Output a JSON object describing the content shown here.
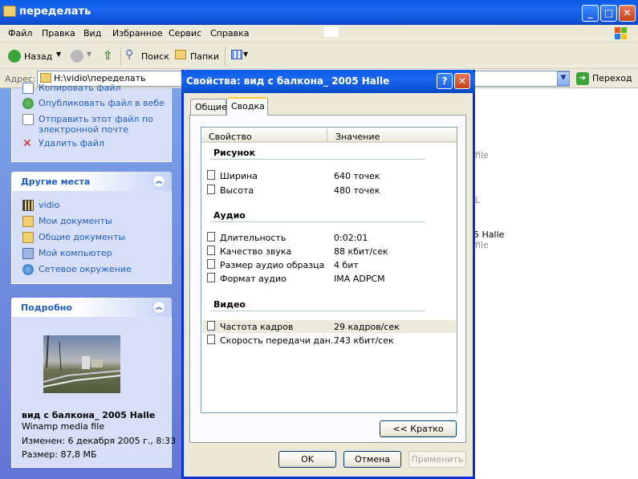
{
  "window": {
    "title": "переделать",
    "menu": [
      "Файл",
      "Правка",
      "Вид",
      "Избранное",
      "Сервис",
      "Справка"
    ],
    "toolbar": {
      "back": "Назад",
      "search": "Поиск",
      "folders": "Папки"
    },
    "address": {
      "label": "Адрес:",
      "value": "H:\\vidio\\переделать",
      "go": "Переход"
    }
  },
  "left_pane": {
    "tasks": [
      "Копировать файл",
      "Опубликовать файл в вебе",
      "Отправить этот файл по",
      "электронной почте",
      "Удалить файл"
    ],
    "other_places": {
      "title": "Другие места",
      "items": [
        "vidio",
        "Мои документы",
        "Общие документы",
        "Мой компьютер",
        "Сетевое окружение"
      ]
    },
    "details": {
      "title": "Подробно",
      "name": "вид с балкона_ 2005 Halle",
      "type": "Winamp media file",
      "modified": "Изменен: 6 декабря 2005 г., 8:33",
      "size": "Размер: 87,8 МБ"
    }
  },
  "main_ghost": [
    "file",
    "L",
    "5 Halle",
    "file"
  ],
  "dialog": {
    "title": "Свойства: вид с балкона_ 2005 Halle",
    "tabs": [
      "Общие",
      "Сводка"
    ],
    "columns": [
      "Свойство",
      "Значение"
    ],
    "groups": {
      "picture": {
        "title": "Рисунок",
        "rows": [
          {
            "p": "Ширина",
            "v": "640 точек"
          },
          {
            "p": "Высота",
            "v": "480 точек"
          }
        ]
      },
      "audio": {
        "title": "Аудио",
        "rows": [
          {
            "p": "Длительность",
            "v": "0:02:01"
          },
          {
            "p": "Качество звука",
            "v": "88 кбит/сек"
          },
          {
            "p": "Размер аудио образца",
            "v": "4 бит"
          },
          {
            "p": "Формат аудио",
            "v": "IMA ADPCM"
          }
        ]
      },
      "video": {
        "title": "Видео",
        "rows": [
          {
            "p": "Частота кадров",
            "v": "29 кадров/сек"
          },
          {
            "p": "Скорость передачи дан...",
            "v": "743 кбит/сек"
          }
        ]
      }
    },
    "brief_button": "<< Кратко",
    "ok": "OK",
    "cancel": "Отмена",
    "apply": "Применить"
  }
}
